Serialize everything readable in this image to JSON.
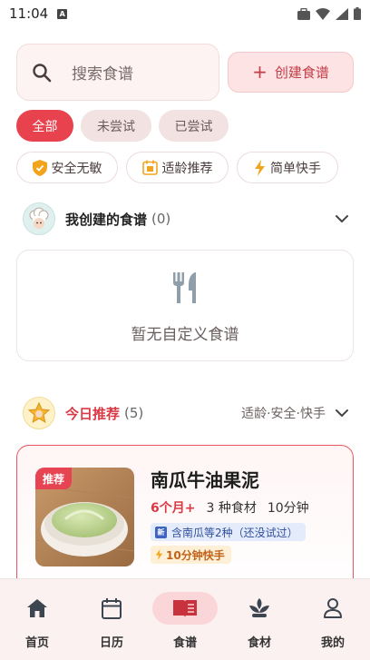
{
  "status_bar": {
    "time": "11:04",
    "a_badge": "A"
  },
  "search": {
    "placeholder": "搜索食谱"
  },
  "create_button": {
    "plus": "+",
    "label": "创建食谱"
  },
  "filters": {
    "all": "全部",
    "untried": "未尝试",
    "tried": "已尝试"
  },
  "tags": {
    "safe": "安全无敏",
    "age": "适龄推荐",
    "quick": "简单快手"
  },
  "my_recipes": {
    "title": "我创建的食谱",
    "count": "(0)",
    "empty_text": "暂无自定义食谱"
  },
  "today": {
    "title": "今日推荐",
    "count": "(5)",
    "filter_summary": "适龄·安全·快手"
  },
  "recipe": {
    "badge": "推荐",
    "name": "南瓜牛油果泥",
    "age": "6个月+",
    "ingredients": "3 种食材",
    "time": "10分钟",
    "new_badge": "新",
    "note": "含南瓜等2种（还没试过）",
    "quick_tag": "10分钟快手"
  },
  "nav": [
    {
      "label": "首页",
      "icon": "home-icon"
    },
    {
      "label": "日历",
      "icon": "calendar-icon"
    },
    {
      "label": "食谱",
      "icon": "book-icon"
    },
    {
      "label": "食材",
      "icon": "sprout-icon"
    },
    {
      "label": "我的",
      "icon": "person-icon"
    }
  ],
  "colors": {
    "accent": "#e8424e",
    "chip_bg": "#f2e2e2",
    "nav_bg": "#fbf1f0"
  }
}
